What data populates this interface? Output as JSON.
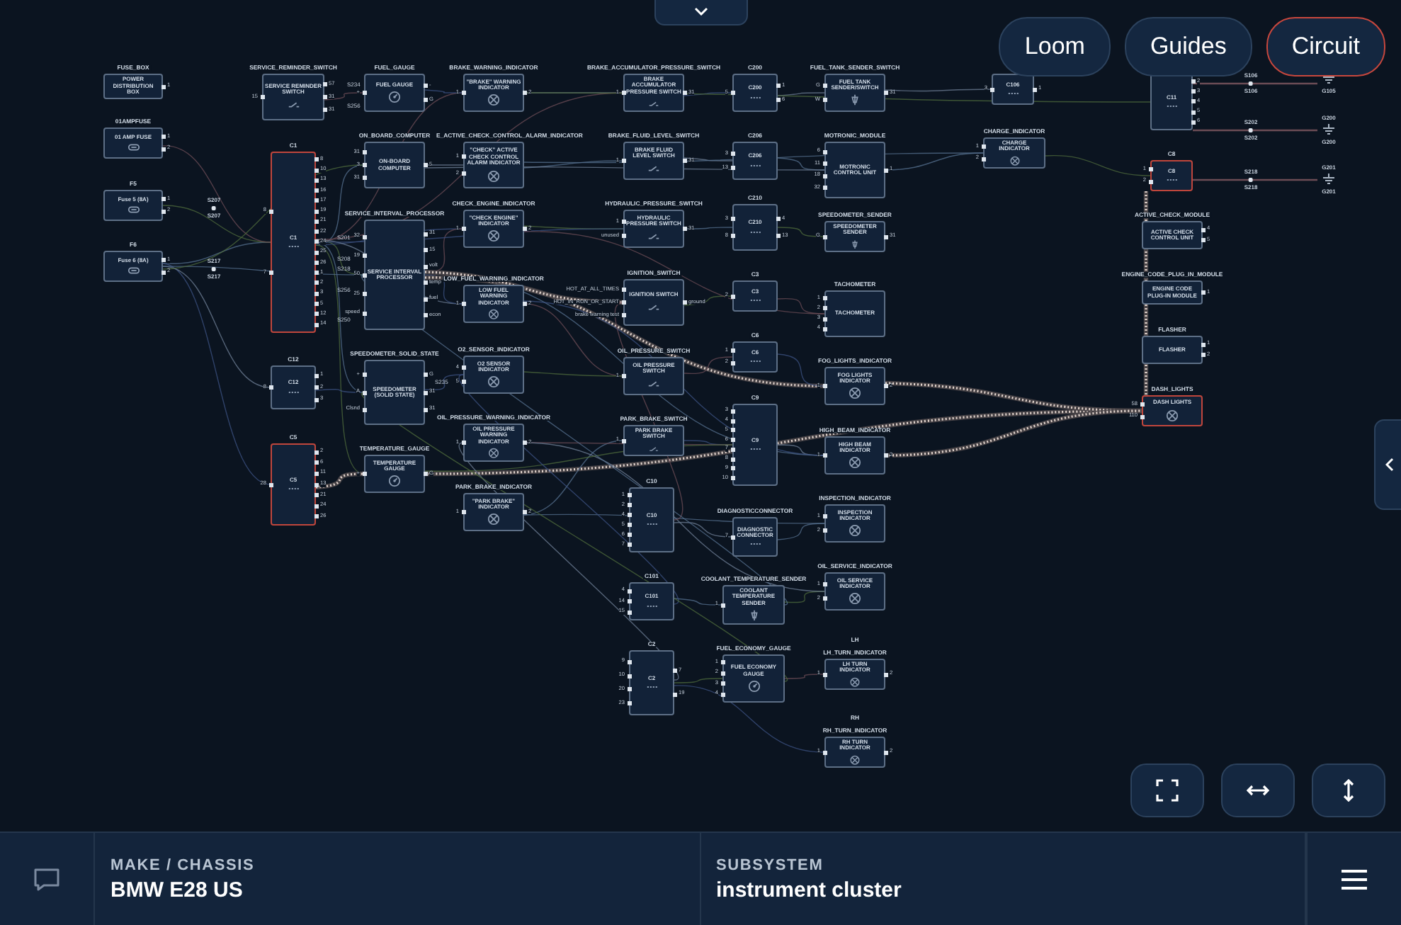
{
  "view_buttons": [
    {
      "label": "Loom",
      "selected": false
    },
    {
      "label": "Guides",
      "selected": false
    },
    {
      "label": "Circuit",
      "selected": true
    }
  ],
  "nodes": [
    {
      "title": "FUSE_BOX",
      "label": "POWER DISTRIBUTION BOX",
      "kind": "unit",
      "highlighted": false,
      "right_pins": [
        "1"
      ]
    },
    {
      "title": "01AMPFUSE",
      "label": "01 AMP FUSE",
      "kind": "fuse",
      "highlighted": false,
      "right_pins": [
        "1",
        "2"
      ]
    },
    {
      "title": "F5",
      "label": "Fuse 5 (8A)",
      "kind": "fuse",
      "highlighted": false,
      "right_pins": [
        "1",
        "2"
      ]
    },
    {
      "title": "F6",
      "label": "Fuse 6 (8A)",
      "kind": "fuse",
      "highlighted": false,
      "right_pins": [
        "1",
        "2"
      ]
    },
    {
      "title": "SERVICE_REMINDER_SWITCH",
      "label": "SERVICE REMINDER SWITCH",
      "kind": "switch",
      "highlighted": false,
      "left_pins": [
        "15"
      ],
      "right_pins": [
        "57",
        "31",
        "31"
      ]
    },
    {
      "title": "C1",
      "label": "C1",
      "kind": "connector",
      "highlighted": true,
      "left_pins": [
        "8",
        "7"
      ],
      "right_pins": [
        "8",
        "10",
        "13",
        "16",
        "17",
        "19",
        "21",
        "22",
        "24",
        "25",
        "26",
        "1",
        "2",
        "3",
        "5",
        "12",
        "14"
      ]
    },
    {
      "title": "C12",
      "label": "C12",
      "kind": "connector",
      "highlighted": false,
      "left_pins": [
        "8"
      ],
      "right_pins": [
        "1",
        "2",
        "3"
      ]
    },
    {
      "title": "C5",
      "label": "C5",
      "kind": "connector",
      "highlighted": true,
      "left_pins": [
        "28"
      ],
      "right_pins": [
        "2",
        "6",
        "11",
        "13",
        "21",
        "24",
        "26"
      ]
    },
    {
      "title": "FUEL_GAUGE",
      "label": "FUEL GAUGE",
      "kind": "gauge",
      "highlighted": false,
      "left_pins": [
        "+"
      ],
      "right_pins": [
        "-",
        "G"
      ]
    },
    {
      "title": "ON_BOARD_COMPUTER",
      "label": "ON-BOARD COMPUTER",
      "kind": "unit",
      "highlighted": false,
      "left_pins": [
        "31",
        "3",
        "31"
      ],
      "right_pins": [
        "5"
      ]
    },
    {
      "title": "SERVICE_INTERVAL_PROCESSOR",
      "label": "SERVICE INTERVAL PROCESSOR",
      "kind": "unit",
      "highlighted": false,
      "left_pins": [
        "32",
        "19",
        "50",
        "25",
        "speed"
      ],
      "right_pins": [
        "31",
        "15",
        "volt",
        "temp",
        "fuel",
        "econ"
      ]
    },
    {
      "title": "SPEEDOMETER_SOLID_STATE",
      "label": "SPEEDOMETER (SOLID STATE)",
      "kind": "unit",
      "highlighted": false,
      "left_pins": [
        "+",
        "A",
        "Clsnd"
      ],
      "right_pins": [
        "G",
        "31",
        "31"
      ]
    },
    {
      "title": "TEMPERATURE_GAUGE",
      "label": "TEMPERATURE GAUGE",
      "kind": "gauge",
      "highlighted": false,
      "left_pins": [
        "+"
      ],
      "right_pins": [
        "G"
      ]
    },
    {
      "title": "BRAKE_WARNING_INDICATOR",
      "label": "\"BRAKE\" WARNING INDICATOR",
      "kind": "lamp",
      "highlighted": false,
      "left_pins": [
        "1"
      ],
      "right_pins": [
        "2"
      ]
    },
    {
      "title": "E_ACTIVE_CHECK_CONTROL_ALARM_INDICATOR",
      "label": "\"CHECK\" ACTIVE CHECK CONTROL ALARM INDICATOR",
      "kind": "lamp",
      "highlighted": false,
      "left_pins": [
        "1",
        "2"
      ]
    },
    {
      "title": "CHECK_ENGINE_INDICATOR",
      "label": "\"CHECK ENGINE\" INDICATOR",
      "kind": "lamp",
      "highlighted": false,
      "left_pins": [
        "1"
      ],
      "right_pins": [
        "2"
      ]
    },
    {
      "title": "LOW_FUEL_WARNING_INDICATOR",
      "label": "LOW FUEL WARNING INDICATOR",
      "kind": "lamp",
      "highlighted": false,
      "left_pins": [
        "1"
      ],
      "right_pins": [
        "2"
      ]
    },
    {
      "title": "O2_SENSOR_INDICATOR",
      "label": "O2 SENSOR INDICATOR",
      "kind": "lamp",
      "highlighted": false,
      "left_pins": [
        "4",
        "5"
      ]
    },
    {
      "title": "OIL_PRESSURE_WARNING_INDICATOR",
      "label": "OIL PRESSURE WARNING INDICATOR",
      "kind": "lamp",
      "highlighted": false,
      "left_pins": [
        "1"
      ],
      "right_pins": [
        "2"
      ]
    },
    {
      "title": "PARK_BRAKE_INDICATOR",
      "label": "\"PARK BRAKE\" INDICATOR",
      "kind": "lamp",
      "highlighted": false,
      "left_pins": [
        "1"
      ],
      "right_pins": [
        "2"
      ]
    },
    {
      "title": "BRAKE_ACCUMULATOR_PRESSURE_SWITCH",
      "label": "BRAKE ACCUMULATOR PRESSURE SWITCH",
      "kind": "switch",
      "highlighted": false,
      "left_pins": [
        "1"
      ],
      "right_pins": [
        "31"
      ]
    },
    {
      "title": "BRAKE_FLUID_LEVEL_SWITCH",
      "label": "BRAKE FLUID LEVEL SWITCH",
      "kind": "switch",
      "highlighted": false,
      "left_pins": [
        "1"
      ],
      "right_pins": [
        "31"
      ]
    },
    {
      "title": "HYDRAULIC_PRESSURE_SWITCH",
      "label": "HYDRAULIC PRESSURE SWITCH",
      "kind": "switch",
      "highlighted": false,
      "left_pins": [
        "1",
        "unused"
      ],
      "right_pins": [
        "31"
      ]
    },
    {
      "title": "IGNITION_SWITCH",
      "label": "IGNITION SWITCH",
      "kind": "switch",
      "highlighted": false,
      "left_pins": [
        "HOT_AT_ALL_TIMES",
        "HOT_IN_RUN_OR_START",
        "brake warning test"
      ],
      "right_pins": [
        "ground"
      ]
    },
    {
      "title": "OIL_PRESSURE_SWITCH",
      "label": "OIL PRESSURE SWITCH",
      "kind": "switch",
      "highlighted": false,
      "left_pins": [
        "1"
      ]
    },
    {
      "title": "PARK_BRAKE_SWITCH",
      "label": "PARK BRAKE SWITCH",
      "kind": "switch",
      "highlighted": false,
      "left_pins": [
        "1"
      ]
    },
    {
      "title": "C10",
      "label": "C10",
      "kind": "connector",
      "highlighted": false,
      "left_pins": [
        "1",
        "2",
        "4",
        "5",
        "6",
        "7"
      ]
    },
    {
      "title": "C101",
      "label": "C101",
      "kind": "connector",
      "highlighted": false,
      "left_pins": [
        "4",
        "14",
        "15"
      ]
    },
    {
      "title": "C2",
      "label": "C2",
      "kind": "connector",
      "highlighted": false,
      "left_pins": [
        "9",
        "10",
        "20",
        "23"
      ],
      "right_pins": [
        "7",
        "19"
      ]
    },
    {
      "title": "C200",
      "label": "C200",
      "kind": "connector",
      "highlighted": false,
      "left_pins": [
        "5"
      ],
      "right_pins": [
        "1",
        "6"
      ]
    },
    {
      "title": "C206",
      "label": "C206",
      "kind": "connector",
      "highlighted": false,
      "left_pins": [
        "3",
        "13"
      ]
    },
    {
      "title": "C210",
      "label": "C210",
      "kind": "connector",
      "highlighted": false,
      "left_pins": [
        "3",
        "8"
      ],
      "right_pins": [
        "4",
        "13"
      ]
    },
    {
      "title": "C3",
      "label": "C3",
      "kind": "connector",
      "highlighted": false,
      "left_pins": [
        "2"
      ]
    },
    {
      "title": "C6",
      "label": "C6",
      "kind": "connector",
      "highlighted": false,
      "left_pins": [
        "1",
        "2"
      ]
    },
    {
      "title": "C9",
      "label": "C9",
      "kind": "connector",
      "highlighted": false,
      "left_pins": [
        "3",
        "4",
        "5",
        "6",
        "7",
        "8",
        "9",
        "10"
      ]
    },
    {
      "title": "DIAGNOSTICCONNECTOR",
      "label": "DIAGNOSTIC CONNECTOR",
      "kind": "connector",
      "highlighted": false,
      "left_pins": [
        "7"
      ]
    },
    {
      "title": "COOLANT_TEMPERATURE_SENDER",
      "label": "COOLANT TEMPERATURE SENDER",
      "kind": "sensor",
      "highlighted": false,
      "left_pins": [
        "1"
      ]
    },
    {
      "title": "FUEL_ECONOMY_GAUGE",
      "label": "FUEL ECONOMY GAUGE",
      "kind": "gauge",
      "highlighted": false,
      "left_pins": [
        "1",
        "2",
        "3",
        "4"
      ]
    },
    {
      "title": "FUEL_TANK_SENDER_SWITCH",
      "label": "FUEL TANK SENDER/SWITCH",
      "kind": "sensor",
      "highlighted": false,
      "left_pins": [
        "G",
        "W"
      ],
      "right_pins": [
        "31"
      ]
    },
    {
      "title": "MOTRONIC_MODULE",
      "label": "MOTRONIC CONTROL UNIT",
      "kind": "unit",
      "highlighted": false,
      "left_pins": [
        "6",
        "11",
        "18",
        "32"
      ],
      "right_pins": [
        "1"
      ]
    },
    {
      "title": "SPEEDOMETER_SENDER",
      "label": "SPEEDOMETER SENDER",
      "kind": "sensor",
      "highlighted": false,
      "left_pins": [
        "G"
      ],
      "right_pins": [
        "31"
      ]
    },
    {
      "title": "TACHOMETER",
      "label": "TACHOMETER",
      "kind": "unit",
      "highlighted": false,
      "left_pins": [
        "1",
        "2",
        "3",
        "4"
      ]
    },
    {
      "title": "FOG_LIGHTS_INDICATOR",
      "label": "FOG LIGHTS INDICATOR",
      "kind": "lamp",
      "highlighted": false,
      "left_pins": [
        "1"
      ],
      "right_pins": [
        "2"
      ]
    },
    {
      "title": "HIGH_BEAM_INDICATOR",
      "label": "HIGH BEAM INDICATOR",
      "kind": "lamp",
      "highlighted": false,
      "left_pins": [
        "1"
      ],
      "right_pins": [
        "2"
      ]
    },
    {
      "title": "INSPECTION_INDICATOR",
      "label": "INSPECTION INDICATOR",
      "kind": "lamp",
      "highlighted": false,
      "left_pins": [
        "1",
        "2"
      ]
    },
    {
      "title": "OIL_SERVICE_INDICATOR",
      "label": "OIL SERVICE INDICATOR",
      "kind": "lamp",
      "highlighted": false,
      "left_pins": [
        "1",
        "2"
      ]
    },
    {
      "tag": "LH",
      "title": "LH_TURN_INDICATOR",
      "label": "LH TURN INDICATOR",
      "kind": "lamp",
      "highlighted": false,
      "left_pins": [
        "1"
      ],
      "right_pins": [
        "2"
      ]
    },
    {
      "tag": "RH",
      "title": "RH_TURN_INDICATOR",
      "label": "RH TURN INDICATOR",
      "kind": "lamp",
      "highlighted": false,
      "left_pins": [
        "1"
      ],
      "right_pins": [
        "2"
      ]
    },
    {
      "label": "C106",
      "kind": "connector",
      "highlighted": false,
      "left_pins": [
        "3"
      ],
      "right_pins": [
        "1"
      ]
    },
    {
      "title": "CHARGE_INDICATOR",
      "label": "CHARGE INDICATOR",
      "kind": "lamp",
      "highlighted": false,
      "left_pins": [
        "1",
        "2"
      ]
    },
    {
      "label": "C11",
      "kind": "connector",
      "highlighted": false,
      "right_pins": [
        "2",
        "3",
        "4",
        "5",
        "6"
      ]
    },
    {
      "title": "C8",
      "label": "C8",
      "kind": "connector",
      "highlighted": true,
      "left_pins": [
        "1",
        "2"
      ]
    },
    {
      "title": "ACTIVE_CHECK_MODULE",
      "label": "ACTIVE CHECK CONTROL UNIT",
      "kind": "unit",
      "highlighted": false,
      "right_pins": [
        "4",
        "5"
      ]
    },
    {
      "title": "ENGINE_CODE_PLUG_IN_MODULE",
      "label": "ENGINE CODE PLUG-IN MODULE",
      "kind": "unit",
      "highlighted": false,
      "right_pins": [
        "1"
      ]
    },
    {
      "title": "FLASHER",
      "label": "FLASHER",
      "kind": "unit",
      "highlighted": false,
      "right_pins": [
        "1",
        "2"
      ]
    },
    {
      "title": "DASH_LIGHTS",
      "label": "DASH LIGHTS",
      "kind": "lamp",
      "highlighted": true,
      "left_pins": [
        "58",
        "110"
      ]
    }
  ],
  "splices": [
    {
      "label_above": "S207",
      "label_below": "S207"
    },
    {
      "label_above": "S217",
      "label_below": "S217"
    },
    {
      "label_above": "S106",
      "label_below": "S106"
    },
    {
      "label_above": "S202",
      "label_below": "S202"
    },
    {
      "label_above": "S218",
      "label_below": "S218"
    }
  ],
  "grounds": [
    {
      "label_below": "G105"
    },
    {
      "label_above": "G200",
      "label_below": "G200"
    },
    {
      "label_above": "G201",
      "label_below": "G201"
    }
  ],
  "wire_labels": [
    "S234",
    "S256",
    "S201",
    "S208",
    "S218",
    "S256",
    "S250",
    "S235"
  ],
  "footer": {
    "make_label": "MAKE / CHASSIS",
    "make_value": "BMW E28 US",
    "subsystem_label": "SUBSYSTEM",
    "subsystem_value": "instrument cluster"
  }
}
